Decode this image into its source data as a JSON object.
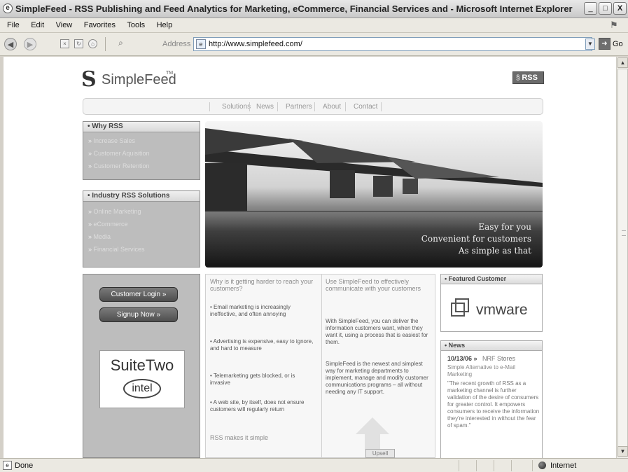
{
  "window": {
    "title": "SimpleFeed - RSS Publishing and Feed Analytics for Marketing, eCommerce, Financial Services and - Microsoft Internet Explorer",
    "controls": [
      "_",
      "□",
      "X"
    ]
  },
  "menu": [
    "File",
    "Edit",
    "View",
    "Favorites",
    "Tools",
    "Help"
  ],
  "toolbar": {
    "address_label": "Address",
    "url": "http://www.simplefeed.com/",
    "go_label": "Go"
  },
  "status": {
    "left": "Done",
    "zone": "Internet"
  },
  "page": {
    "logo": "SimpleFeed",
    "logo_tm": "TM",
    "rss_badge": "RSS",
    "nav": [
      "Solutions",
      "News",
      "Partners",
      "About",
      "Contact"
    ],
    "why_rss": {
      "title": "Why RSS",
      "links": [
        "Increase Sales",
        "Customer Aquisition",
        "Customer Retention"
      ]
    },
    "industry": {
      "title": "Industry RSS Solutions",
      "links": [
        "Online Marketing",
        "eCommerce",
        "Media",
        "Financial Services"
      ]
    },
    "hero_lines": [
      "Easy for you",
      "Convenient for customers",
      "As simple as that"
    ],
    "login_button": "Customer Login",
    "signup_button": "Signup Now",
    "suite_title": "SuiteTwo",
    "intel_label": "intel",
    "col1": {
      "heading": "Why is it getting harder to reach your customers?",
      "bullets": [
        "• Email marketing is increasingly ineffective, and often annoying",
        "• Advertising is expensive, easy to ignore, and hard to measure",
        "• Telemarketing gets blocked, or is invasive",
        "• A web site, by itself, does not ensure customers will regularly return"
      ],
      "subheading": "RSS makes it simple"
    },
    "col2": {
      "heading": "Use SimpleFeed to effectively communicate with your customers",
      "para1": "With SimpleFeed, you can deliver the information customers want, when they want it, using a process that is easiest for them.",
      "para2": "SimpleFeed is the newest and simplest way for marketing departments to implement, manage and modify customer communications programs – all without needing any IT support.",
      "button": "Upsell"
    },
    "featured": {
      "title": "Featured Customer",
      "logo": "vmware"
    },
    "news": {
      "title": "News",
      "date": "10/13/06 »",
      "headline": "NRF Stores",
      "sub": "Simple Alternative to e-Mail Marketing",
      "quote": "\"The recent growth of RSS as a marketing channel is further validation of the desire of consumers for greater control. It empowers consumers to receive the information they're interested in without the fear of spam.\""
    }
  }
}
